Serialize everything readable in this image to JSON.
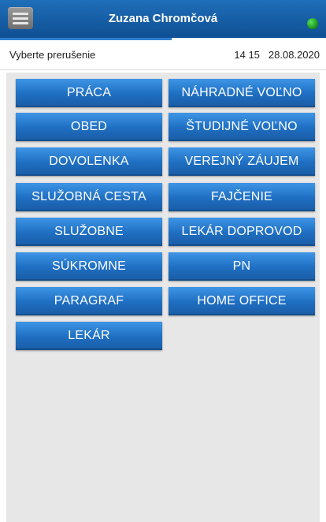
{
  "header": {
    "user_name": "Zuzana Chromčová",
    "status_color": "#1c9a1c",
    "menu_icon": "hamburger-menu-icon"
  },
  "subheader": {
    "prompt": "Vyberte prerušenie",
    "time": "14 15",
    "date": "28.08.2020"
  },
  "colors": {
    "header_bg": "#1f6fb9",
    "button_bg": "#1f6fc3",
    "content_bg": "#e7e7e7"
  },
  "buttons": {
    "praca": "PRÁCA",
    "nahradne_volno": "NÁHRADNÉ VOĽNO",
    "obed": "OBED",
    "studijne_volno": "ŠTUDIJNÉ VOĽNO",
    "dovolenka": "DOVOLENKA",
    "verejny_zaujem": "VEREJNÝ ZÁUJEM",
    "sluzobna_cesta": "SLUŽOBNÁ CESTA",
    "fajcenie": "FAJČENIE",
    "sluzobne": "SLUŽOBNE",
    "lekar_doprovod": "LEKÁR DOPROVOD",
    "sukromne": "SÚKROMNE",
    "pn": "PN",
    "paragraf": "PARAGRAF",
    "home_office": "HOME OFFICE",
    "lekar": "LEKÁR"
  }
}
